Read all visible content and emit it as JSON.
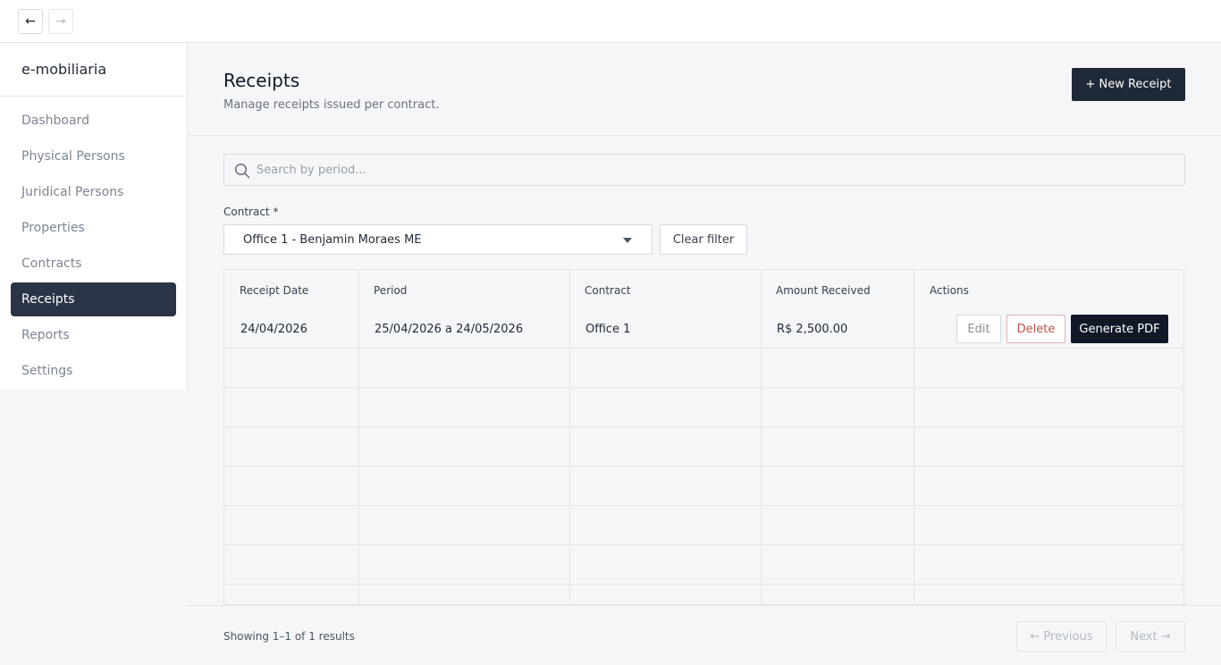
{
  "nav": {
    "back_icon": "←",
    "forward_icon": "→"
  },
  "sidebar": {
    "brand": "e-mobiliaria",
    "items": [
      {
        "label": "Dashboard"
      },
      {
        "label": "Physical Persons"
      },
      {
        "label": "Juridical Persons"
      },
      {
        "label": "Properties"
      },
      {
        "label": "Contracts"
      },
      {
        "label": "Receipts",
        "active": true
      },
      {
        "label": "Reports"
      },
      {
        "label": "Settings"
      }
    ]
  },
  "header": {
    "title": "Receipts",
    "subtitle": "Manage receipts issued per contract.",
    "new_button": "+ New Receipt"
  },
  "search": {
    "placeholder": "Search by period..."
  },
  "filter": {
    "contract_label": "Contract *",
    "selected": "Office 1 - Benjamin Moraes ME",
    "clear_label": "Clear filter"
  },
  "table": {
    "columns": [
      "Receipt Date",
      "Period",
      "Contract",
      "Amount Received",
      "Actions"
    ],
    "rows": [
      {
        "receipt_date": "24/04/2026",
        "period": "25/04/2026 a 24/05/2026",
        "contract": "Office 1",
        "amount": "R$ 2,500.00",
        "actions": {
          "edit": "Edit",
          "delete": "Delete",
          "pdf": "Generate PDF"
        }
      }
    ]
  },
  "footer": {
    "results": "Showing 1–1 of 1 results",
    "previous": "← Previous",
    "next": "Next →"
  },
  "colors": {
    "sidebar_active": "#2b3446",
    "primary_button": "#1f2937",
    "delete_text": "#c0504d",
    "background": "#f4f6f8"
  }
}
